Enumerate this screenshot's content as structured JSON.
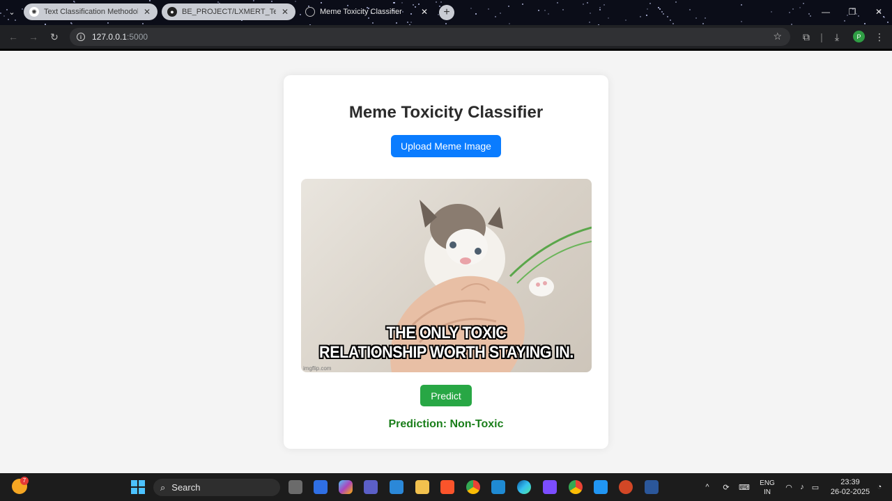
{
  "browser": {
    "tabs": [
      {
        "title": "Text Classification Methodologie",
        "state": "inactive",
        "icon": "openai-icon"
      },
      {
        "title": "BE_PROJECT/LXMERT_Test.ipynb",
        "state": "inactive",
        "icon": "github-icon"
      },
      {
        "title": "Meme Toxicity Classifier",
        "state": "active",
        "icon": "globe-icon"
      }
    ],
    "url_host": "127.0.0.1",
    "url_port": ":5000",
    "profile_initial": "P"
  },
  "page": {
    "title": "Meme Toxicity Classifier",
    "upload_label": "Upload Meme Image",
    "meme_caption_line1": "THE ONLY TOXIC",
    "meme_caption_line2": "RELATIONSHIP WORTH STAYING IN.",
    "meme_watermark": "imgflip.com",
    "predict_label": "Predict",
    "prediction_text": "Prediction: Non-Toxic",
    "colors": {
      "upload": "#0a7cff",
      "predict": "#28a745",
      "prediction": "#1a7e1a"
    }
  },
  "taskbar": {
    "search_label": "Search",
    "weather_badge": "7",
    "lang_line1": "ENG",
    "lang_line2": "IN",
    "time": "23:39",
    "date": "26-02-2025"
  }
}
